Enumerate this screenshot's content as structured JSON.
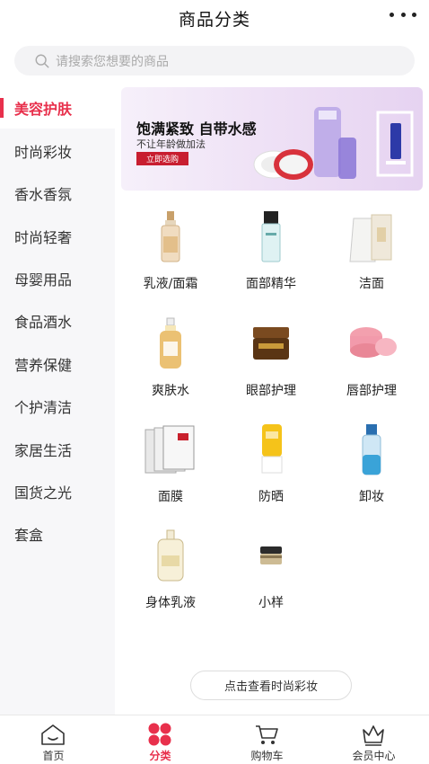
{
  "header": {
    "title": "商品分类"
  },
  "search": {
    "placeholder": "请搜索您想要的商品"
  },
  "sidebar": {
    "items": [
      {
        "label": "美容护肤",
        "active": true
      },
      {
        "label": "时尚彩妆"
      },
      {
        "label": "香水香氛"
      },
      {
        "label": "时尚轻奢"
      },
      {
        "label": "母婴用品"
      },
      {
        "label": "食品酒水"
      },
      {
        "label": "营养保健"
      },
      {
        "label": "个护清洁"
      },
      {
        "label": "家居生活"
      },
      {
        "label": "国货之光"
      },
      {
        "label": "套盒"
      }
    ]
  },
  "banner": {
    "title": "饱满紧致 自带水感",
    "subtitle": "不让年龄做加法",
    "button": "立即选购"
  },
  "categories": [
    {
      "label": "乳液/面霜",
      "icon": "lotion-bottle-icon"
    },
    {
      "label": "面部精华",
      "icon": "serum-bottle-icon"
    },
    {
      "label": "洁面",
      "icon": "cleanser-tube-icon"
    },
    {
      "label": "爽肤水",
      "icon": "toner-bottle-icon"
    },
    {
      "label": "眼部护理",
      "icon": "eye-cream-jar-icon"
    },
    {
      "label": "唇部护理",
      "icon": "lip-balm-jar-icon"
    },
    {
      "label": "面膜",
      "icon": "face-mask-icon"
    },
    {
      "label": "防晒",
      "icon": "sunscreen-tube-icon"
    },
    {
      "label": "卸妆",
      "icon": "makeup-remover-icon"
    },
    {
      "label": "身体乳液",
      "icon": "body-lotion-icon"
    },
    {
      "label": "小样",
      "icon": "sample-jar-icon"
    }
  ],
  "more_link": "点击查看时尚彩妆",
  "tabbar": {
    "items": [
      {
        "label": "首页",
        "icon": "home-icon"
      },
      {
        "label": "分类",
        "icon": "category-icon",
        "active": true
      },
      {
        "label": "购物车",
        "icon": "cart-icon"
      },
      {
        "label": "会员中心",
        "icon": "crown-icon"
      }
    ]
  },
  "colors": {
    "accent": "#e8304c",
    "banner_button": "#c81e30",
    "sidebar_bg": "#f7f7f9"
  }
}
